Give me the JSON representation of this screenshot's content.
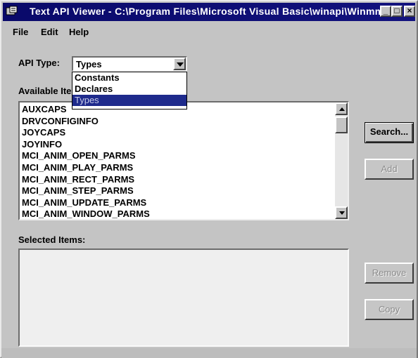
{
  "window": {
    "title": "Text API Viewer - C:\\Program Files\\Microsoft Visual Basic\\winapi\\Winmms..."
  },
  "titlebar_buttons": {
    "minimize": "_",
    "maximize": "□",
    "close": "×"
  },
  "menu": {
    "file": "File",
    "edit": "Edit",
    "help": "Help"
  },
  "api_type": {
    "label": "API Type:",
    "selected": "Types",
    "options": [
      "Constants",
      "Declares",
      "Types"
    ]
  },
  "available_items": {
    "label": "Available Ite",
    "items": [
      "AUXCAPS",
      "DRVCONFIGINFO",
      "JOYCAPS",
      "JOYINFO",
      "MCI_ANIM_OPEN_PARMS",
      "MCI_ANIM_PLAY_PARMS",
      "MCI_ANIM_RECT_PARMS",
      "MCI_ANIM_STEP_PARMS",
      "MCI_ANIM_UPDATE_PARMS",
      "MCI_ANIM_WINDOW_PARMS"
    ]
  },
  "selected_items": {
    "label": "Selected Items:"
  },
  "buttons": {
    "search": "Search...",
    "add": "Add",
    "remove": "Remove",
    "copy": "Copy"
  },
  "colors": {
    "titlebar": "#0a0a6a",
    "selection": "#1e2a8c",
    "face": "#c4c4c4"
  }
}
